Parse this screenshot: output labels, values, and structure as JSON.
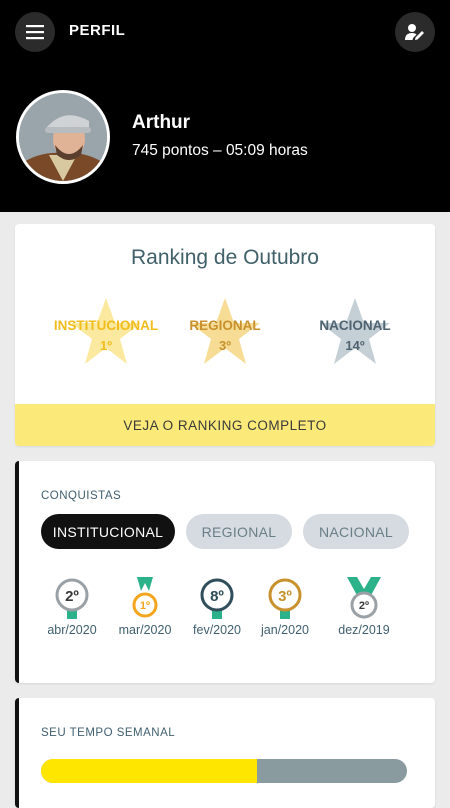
{
  "header": {
    "title": "PERFIL",
    "menu_icon": "menu-icon",
    "edit_icon": "edit-profile-icon"
  },
  "user": {
    "name": "Arthur",
    "stats": "745 pontos – 05:09 horas"
  },
  "ranking": {
    "title": "Ranking de Outubro",
    "items": [
      {
        "label": "INSTITUCIONAL",
        "position": "1º",
        "color": "#f2bc1d",
        "star_color": "#fbe9a0"
      },
      {
        "label": "REGIONAL",
        "position": "3º",
        "color": "#c8912d",
        "star_color": "#f7dc95"
      },
      {
        "label": "NACIONAL",
        "position": "14º",
        "color": "#4f6470",
        "star_color": "#c5cfd6"
      }
    ],
    "cta": "VEJA O RANKING COMPLETO",
    "cta_color": "#fbea7a"
  },
  "achievements": {
    "label": "CONQUISTAS",
    "tabs": [
      {
        "label": "INSTITUCIONAL",
        "active": true
      },
      {
        "label": "REGIONAL",
        "active": false
      },
      {
        "label": "NACIONAL",
        "active": false
      }
    ],
    "medals": [
      {
        "rank": "2º",
        "date": "abr/2020",
        "color": "#9aa1a6",
        "ribbon": "#2cb28a"
      },
      {
        "rank": "1º",
        "date": "mar/2020",
        "color": "#f2a51d",
        "ribbon": "#2cb28a"
      },
      {
        "rank": "8º",
        "date": "fev/2020",
        "color": "#2f4e5a",
        "ribbon": "#2cb28a"
      },
      {
        "rank": "3º",
        "date": "jan/2020",
        "color": "#c8912d",
        "ribbon": "#2cb28a"
      },
      {
        "rank": "2º",
        "date": "dez/2019",
        "color": "#9aa1a6",
        "ribbon": "#2cb28a"
      }
    ]
  },
  "weekly": {
    "label": "SEU TEMPO SEMANAL",
    "progress": 0.59,
    "fill_color": "#ffe600",
    "track_color": "#8a9ba0"
  }
}
